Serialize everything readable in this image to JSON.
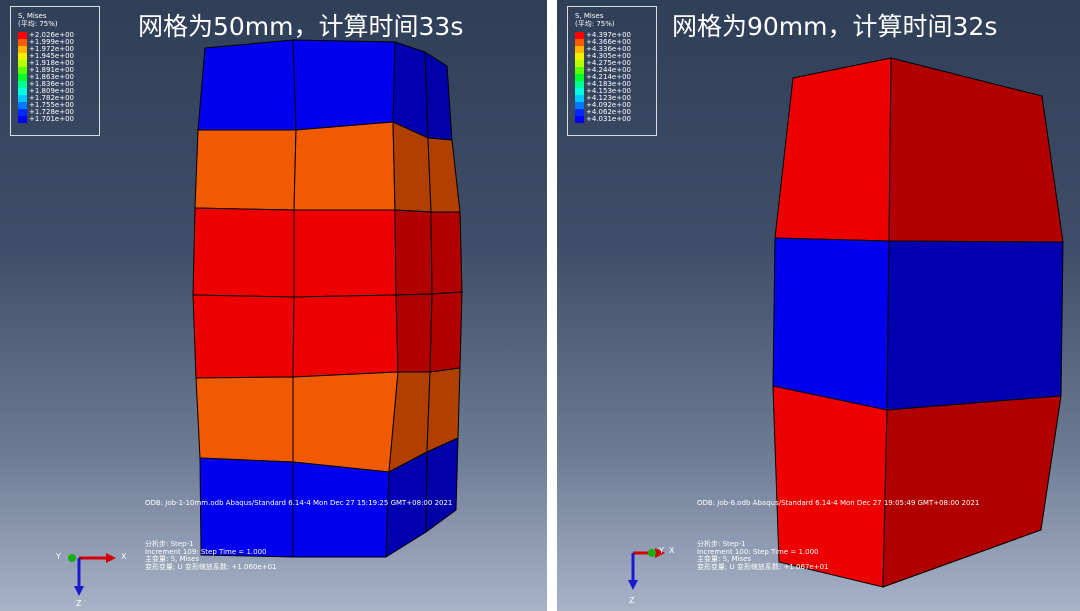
{
  "panels": [
    {
      "headline": "网格为50mm，计算时间33s",
      "legend": {
        "title": "S, Mises",
        "subtitle": "(平均: 75%)",
        "entries": [
          {
            "value": "+2.026e+00",
            "color": "#ff0000"
          },
          {
            "value": "+1.999e+00",
            "color": "#ff5a00"
          },
          {
            "value": "+1.972e+00",
            "color": "#ffb400"
          },
          {
            "value": "+1.945e+00",
            "color": "#f0f000"
          },
          {
            "value": "+1.918e+00",
            "color": "#b4ff00"
          },
          {
            "value": "+1.891e+00",
            "color": "#5aff00"
          },
          {
            "value": "+1.863e+00",
            "color": "#00ff2a"
          },
          {
            "value": "+1.836e+00",
            "color": "#00ff96"
          },
          {
            "value": "+1.809e+00",
            "color": "#00ffdc"
          },
          {
            "value": "+1.782e+00",
            "color": "#00c8ff"
          },
          {
            "value": "+1.755e+00",
            "color": "#0078ff"
          },
          {
            "value": "+1.728e+00",
            "color": "#0028ff"
          },
          {
            "value": "+1.701e+00",
            "color": "#0000ff"
          }
        ]
      },
      "odb_info": "ODB: Job-1-10mm.odb    Abaqus/Standard 6.14-4    Mon Dec 27 15:19:25 GMT+08:00 2021",
      "step_lines": [
        "分析步: Step-1",
        "Increment    109: Step Time =    1.000",
        "主变量: S, Mises",
        "变形变量: U   变形缩放系数: +1.060e+01"
      ],
      "axes": {
        "x": "X",
        "y": "Y",
        "z": "Z"
      }
    },
    {
      "headline": "网格为90mm，计算时间32s",
      "legend": {
        "title": "S, Mises",
        "subtitle": "(平均: 75%)",
        "entries": [
          {
            "value": "+4.397e+00",
            "color": "#ff0000"
          },
          {
            "value": "+4.366e+00",
            "color": "#ff5a00"
          },
          {
            "value": "+4.336e+00",
            "color": "#ffb400"
          },
          {
            "value": "+4.305e+00",
            "color": "#f0f000"
          },
          {
            "value": "+4.275e+00",
            "color": "#b4ff00"
          },
          {
            "value": "+4.244e+00",
            "color": "#5aff00"
          },
          {
            "value": "+4.214e+00",
            "color": "#00ff2a"
          },
          {
            "value": "+4.183e+00",
            "color": "#00ff96"
          },
          {
            "value": "+4.153e+00",
            "color": "#00ffdc"
          },
          {
            "value": "+4.123e+00",
            "color": "#00c8ff"
          },
          {
            "value": "+4.092e+00",
            "color": "#0078ff"
          },
          {
            "value": "+4.062e+00",
            "color": "#0028ff"
          },
          {
            "value": "+4.031e+00",
            "color": "#0000ff"
          }
        ]
      },
      "odb_info": "ODB: Job-6.odb    Abaqus/Standard 6.14-4    Mon Dec 27 19:05:49 GMT+08:00 2021",
      "step_lines": [
        "分析步: Step-1",
        "Increment    100: Step Time =    1.000",
        "主变量: S, Mises",
        "变形变量: U   变形缩放系数: +1.067e+01"
      ],
      "axes": {
        "x": "X",
        "y": "Y",
        "z": "Z"
      }
    }
  ]
}
